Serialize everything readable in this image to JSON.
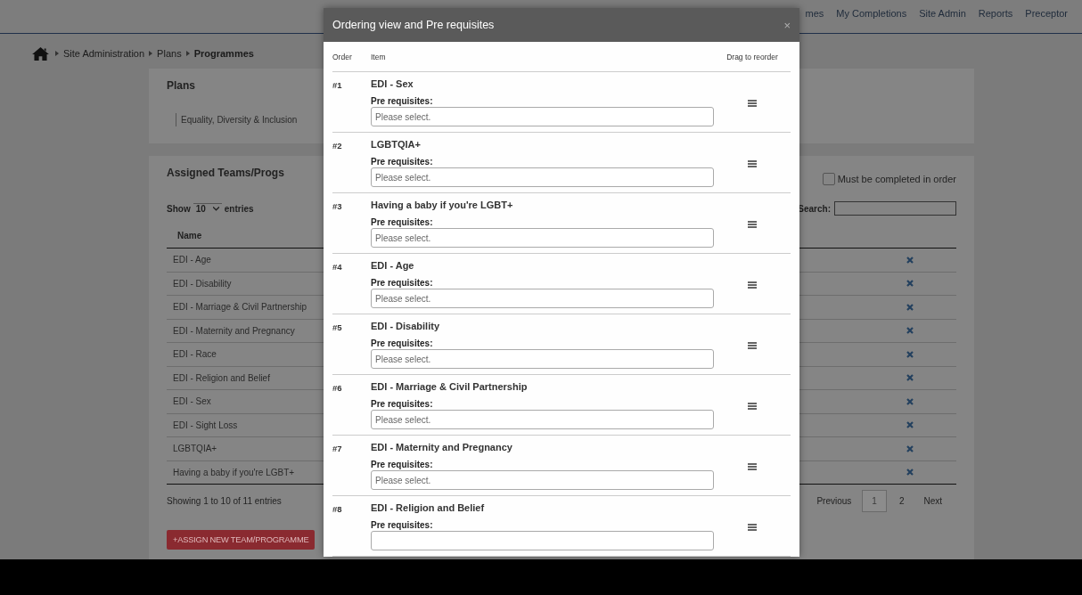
{
  "nav": {
    "items": [
      {
        "label": "mes"
      },
      {
        "label": "My Completions"
      },
      {
        "label": "Site Admin"
      },
      {
        "label": "Reports"
      },
      {
        "label": "Preceptor"
      }
    ]
  },
  "breadcrumb": [
    {
      "label": "Site Administration",
      "current": false
    },
    {
      "label": "Plans",
      "current": false
    },
    {
      "label": "Programmes",
      "current": true
    }
  ],
  "plans_card": {
    "title": "Plans",
    "tags": [
      "Equality, Diversity & Inclusion"
    ]
  },
  "assigned_card": {
    "title": "Assigned Teams/Progs",
    "order_checkbox": {
      "label": "Must be completed in order",
      "checked": false
    },
    "length_menu": {
      "before": "Show",
      "value": "10",
      "after": "entries"
    },
    "search": {
      "label": "Search:"
    },
    "table": {
      "columns": [
        "Name"
      ],
      "rows": [
        {
          "name": "EDI - Age"
        },
        {
          "name": "EDI - Disability"
        },
        {
          "name": "EDI - Marriage & Civil Partnership"
        },
        {
          "name": "EDI - Maternity and Pregnancy"
        },
        {
          "name": "EDI - Race"
        },
        {
          "name": "EDI - Religion and Belief"
        },
        {
          "name": "EDI - Sex"
        },
        {
          "name": "EDI - Sight Loss"
        },
        {
          "name": "LGBTQIA+"
        },
        {
          "name": "Having a baby if you're LGBT+"
        }
      ]
    },
    "info": "Showing 1 to 10 of 11 entries",
    "pagination": [
      {
        "label": "Previous",
        "kind": "prev",
        "selected": false
      },
      {
        "label": "1",
        "kind": "page",
        "selected": true
      },
      {
        "label": "2",
        "kind": "page",
        "selected": false
      },
      {
        "label": "Next",
        "kind": "next",
        "selected": false
      }
    ],
    "assign_button": "+ASSIGN NEW TEAM/PROGRAMME"
  },
  "modal": {
    "title": "Ordering view and Pre requisites",
    "close": "×",
    "columns": [
      "Order",
      "Item",
      "Drag to reorder"
    ],
    "items": [
      {
        "order": "#1",
        "name": "EDI - Sex",
        "prereq_label": "Pre requisites:",
        "placeholder": "Please select."
      },
      {
        "order": "#2",
        "name": "LGBTQIA+",
        "prereq_label": "Pre requisites:",
        "placeholder": "Please select."
      },
      {
        "order": "#3",
        "name": "Having a baby if you're LGBT+",
        "prereq_label": "Pre requisites:",
        "placeholder": "Please select."
      },
      {
        "order": "#4",
        "name": "EDI - Age",
        "prereq_label": "Pre requisites:",
        "placeholder": "Please select."
      },
      {
        "order": "#5",
        "name": "EDI - Disability",
        "prereq_label": "Pre requisites:",
        "placeholder": "Please select."
      },
      {
        "order": "#6",
        "name": "EDI - Marriage & Civil Partnership",
        "prereq_label": "Pre requisites:",
        "placeholder": "Please select."
      },
      {
        "order": "#7",
        "name": "EDI - Maternity and Pregnancy",
        "prereq_label": "Pre requisites:",
        "placeholder": "Please select."
      },
      {
        "order": "#8",
        "name": "EDI - Religion and Belief",
        "prereq_label": "Pre requisites:"
      }
    ]
  }
}
